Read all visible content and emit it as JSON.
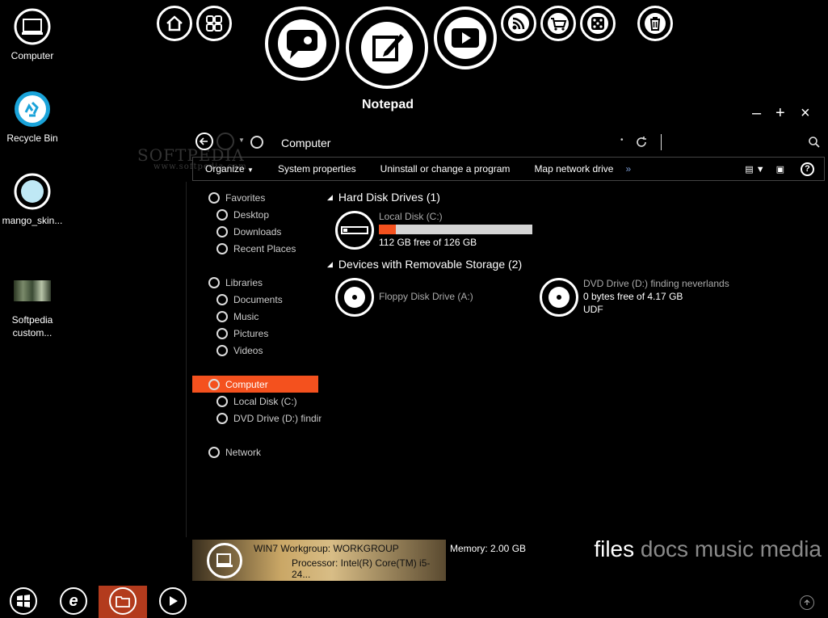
{
  "desktop": {
    "icons": [
      {
        "label": "Computer"
      },
      {
        "label": "Recycle Bin"
      },
      {
        "label": "mango_skin..."
      },
      {
        "label": "Softpedia custom..."
      }
    ]
  },
  "watermark": {
    "name": "SOFTPEDIA",
    "url": "www.softpedia.com"
  },
  "dock": {
    "active_title": "Notepad",
    "items": [
      "home-icon",
      "apps-icon",
      "chat-icon",
      "notepad-icon",
      "play-icon",
      "rss-icon",
      "cart-icon",
      "dice-icon",
      "trash-icon"
    ]
  },
  "window_controls": {
    "minimize": "–",
    "maximize": "+",
    "close": "×"
  },
  "address": {
    "location": "Computer"
  },
  "toolbar": {
    "organize": "Organize",
    "system_properties": "System properties",
    "uninstall": "Uninstall or change a program",
    "map_drive": "Map network drive",
    "more": "»"
  },
  "nav": {
    "favorites": "Favorites",
    "desktop": "Desktop",
    "downloads": "Downloads",
    "recent": "Recent Places",
    "libraries": "Libraries",
    "documents": "Documents",
    "music": "Music",
    "pictures": "Pictures",
    "videos": "Videos",
    "computer": "Computer",
    "local_disk": "Local Disk (C:)",
    "dvd": "DVD Drive (D:) finding neverlands",
    "network": "Network"
  },
  "content": {
    "hdd_group": "Hard Disk Drives (1)",
    "local_disk_name": "Local Disk (C:)",
    "local_disk_free": "112 GB free of 126 GB",
    "local_disk_used_fraction": 0.11,
    "removable_group": "Devices with Removable Storage (2)",
    "floppy_name": "Floppy Disk Drive (A:)",
    "dvd_name": "DVD Drive (D:) finding neverlands",
    "dvd_free": "0 bytes free of 4.17 GB",
    "dvd_fs": "UDF"
  },
  "details": {
    "line1": "WIN7  Workgroup: WORKGROUP",
    "line2": "Processor: Intel(R) Core(TM) i5-24...",
    "memory": "Memory: 2.00 GB"
  },
  "tagline": {
    "first": "files",
    "rest": " docs music media"
  },
  "colors": {
    "accent": "#f4511e",
    "background": "#000000"
  }
}
